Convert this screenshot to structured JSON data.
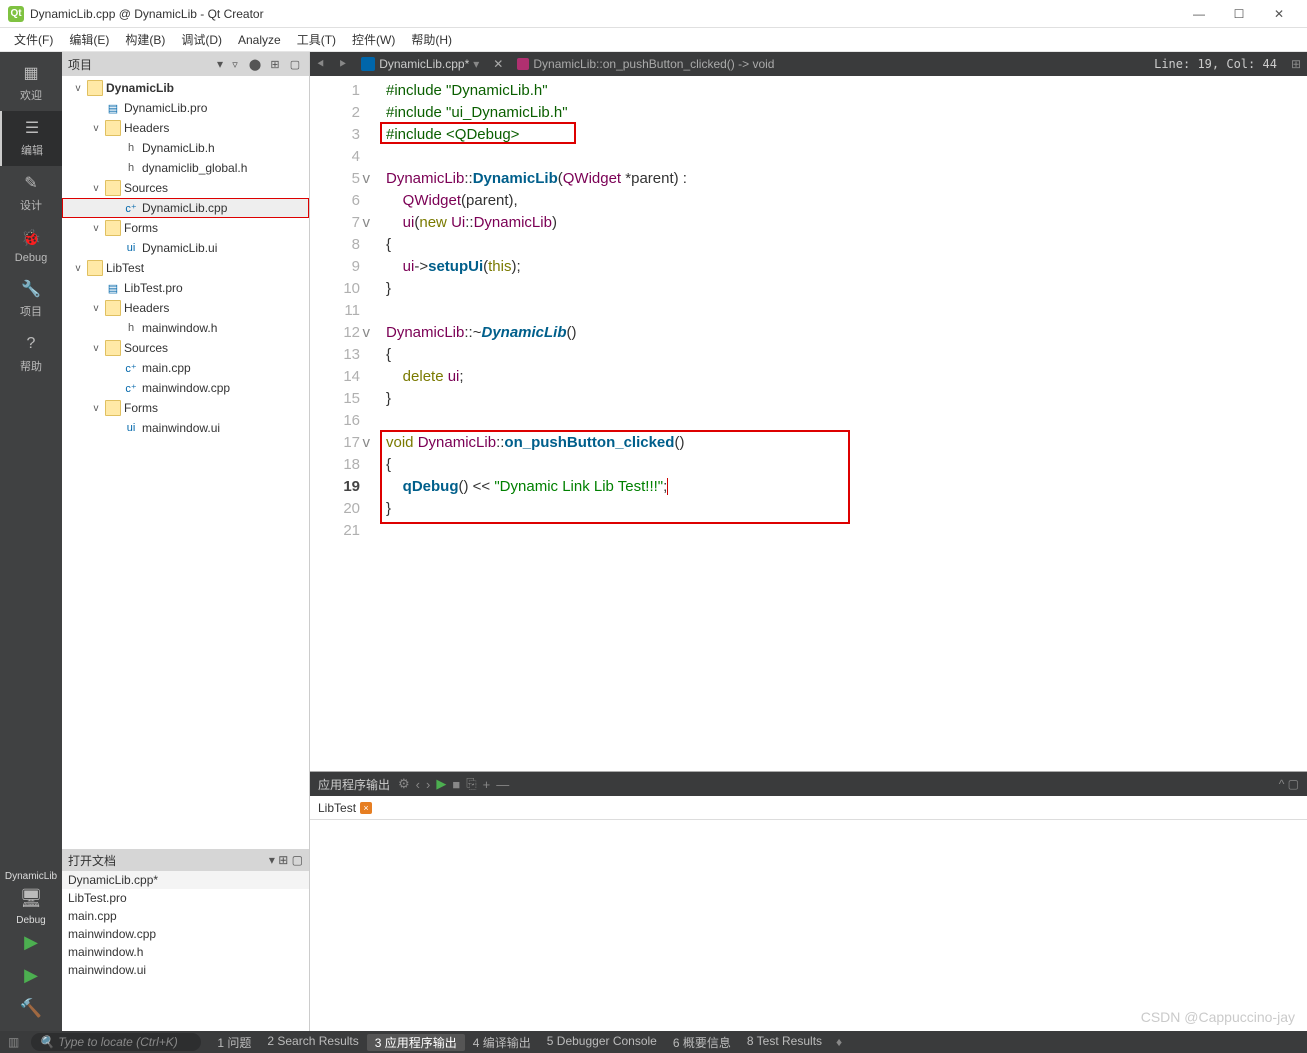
{
  "window": {
    "title": "DynamicLib.cpp @ DynamicLib - Qt Creator"
  },
  "menu": [
    "文件(F)",
    "编辑(E)",
    "构建(B)",
    "调试(D)",
    "Analyze",
    "工具(T)",
    "控件(W)",
    "帮助(H)"
  ],
  "leftbar": {
    "items": [
      {
        "label": "欢迎",
        "icon": "grid-icon"
      },
      {
        "label": "编辑",
        "icon": "edit-icon",
        "active": true
      },
      {
        "label": "设计",
        "icon": "design-icon"
      },
      {
        "label": "Debug",
        "icon": "bug-icon"
      },
      {
        "label": "项目",
        "icon": "wrench-icon"
      },
      {
        "label": "帮助",
        "icon": "help-icon"
      }
    ],
    "target": "DynamicLib",
    "target_mode": "Debug"
  },
  "project_pane": {
    "title": "项目",
    "tree": [
      {
        "ind": 1,
        "arrow": "v",
        "icon": "folder",
        "txt": "DynamicLib",
        "bold": true
      },
      {
        "ind": 2,
        "arrow": "",
        "icon": "pro",
        "txt": "DynamicLib.pro"
      },
      {
        "ind": 2,
        "arrow": "v",
        "icon": "folder",
        "txt": "Headers"
      },
      {
        "ind": 3,
        "arrow": "",
        "icon": "h",
        "txt": "DynamicLib.h"
      },
      {
        "ind": 3,
        "arrow": "",
        "icon": "h",
        "txt": "dynamiclib_global.h"
      },
      {
        "ind": 2,
        "arrow": "v",
        "icon": "folder",
        "txt": "Sources"
      },
      {
        "ind": 3,
        "arrow": "",
        "icon": "cpp",
        "txt": "DynamicLib.cpp",
        "sel": true,
        "redbox": true
      },
      {
        "ind": 2,
        "arrow": "v",
        "icon": "folder",
        "txt": "Forms"
      },
      {
        "ind": 3,
        "arrow": "",
        "icon": "ui",
        "txt": "DynamicLib.ui"
      },
      {
        "ind": 1,
        "arrow": "v",
        "icon": "folder",
        "txt": "LibTest"
      },
      {
        "ind": 2,
        "arrow": "",
        "icon": "pro",
        "txt": "LibTest.pro"
      },
      {
        "ind": 2,
        "arrow": "v",
        "icon": "folder",
        "txt": "Headers"
      },
      {
        "ind": 3,
        "arrow": "",
        "icon": "h",
        "txt": "mainwindow.h"
      },
      {
        "ind": 2,
        "arrow": "v",
        "icon": "folder",
        "txt": "Sources"
      },
      {
        "ind": 3,
        "arrow": "",
        "icon": "cpp",
        "txt": "main.cpp"
      },
      {
        "ind": 3,
        "arrow": "",
        "icon": "cpp",
        "txt": "mainwindow.cpp"
      },
      {
        "ind": 2,
        "arrow": "v",
        "icon": "folder",
        "txt": "Forms"
      },
      {
        "ind": 3,
        "arrow": "",
        "icon": "ui",
        "txt": "mainwindow.ui"
      }
    ],
    "open_title": "打开文档",
    "open_docs": [
      "DynamicLib.cpp*",
      "LibTest.pro",
      "main.cpp",
      "mainwindow.cpp",
      "mainwindow.h",
      "mainwindow.ui"
    ]
  },
  "editor": {
    "tab_name": "DynamicLib.cpp*",
    "breadcrumb": "DynamicLib::on_pushButton_clicked() -> void",
    "position": "Line: 19, Col: 44",
    "lines": [
      {
        "n": 1,
        "html": "<span class='pre'>#include </span><span class='str2'>\"DynamicLib.h\"</span>"
      },
      {
        "n": 2,
        "html": "<span class='pre'>#include </span><span class='str2'>\"ui_DynamicLib.h\"</span>"
      },
      {
        "n": 3,
        "html": "<span class='pre'>#include </span><span class='str2'>&lt;QDebug&gt;</span>"
      },
      {
        "n": 4,
        "html": ""
      },
      {
        "n": 5,
        "fold": "v",
        "html": "<span class='type'>DynamicLib</span>::<span class='fn'>DynamicLib</span>(<span class='type'>QWidget</span> *parent) :"
      },
      {
        "n": 6,
        "html": "    <span class='type'>QWidget</span>(parent),"
      },
      {
        "n": 7,
        "fold": "v",
        "html": "    <span class='type'>ui</span>(<span class='kw'>new</span> <span class='type'>Ui</span>::<span class='type'>DynamicLib</span>)"
      },
      {
        "n": 8,
        "html": "{"
      },
      {
        "n": 9,
        "html": "    <span class='type'>ui</span>-&gt;<span class='fn'>setupUi</span>(<span class='kw'>this</span>);"
      },
      {
        "n": 10,
        "html": "}"
      },
      {
        "n": 11,
        "html": ""
      },
      {
        "n": 12,
        "fold": "v",
        "html": "<span class='type'>DynamicLib</span>::~<span class='fni'>DynamicLib</span>()"
      },
      {
        "n": 13,
        "html": "{"
      },
      {
        "n": 14,
        "html": "    <span class='kw'>delete</span> <span class='type'>ui</span>;"
      },
      {
        "n": 15,
        "html": "}"
      },
      {
        "n": 16,
        "html": ""
      },
      {
        "n": 17,
        "fold": "v",
        "html": "<span class='kw'>void</span> <span class='type'>DynamicLib</span>::<span class='fn'>on_pushButton_clicked</span>()"
      },
      {
        "n": 18,
        "html": "{"
      },
      {
        "n": 19,
        "act": true,
        "html": "    <span class='fn'>qDebug</span>() &lt;&lt; <span class='str'>\"Dynamic Link Lib Test!!!\"</span>;<span class='cursor'></span>"
      },
      {
        "n": 20,
        "html": "}"
      },
      {
        "n": 21,
        "html": ""
      }
    ]
  },
  "output": {
    "title": "应用程序输出",
    "tab": "LibTest"
  },
  "status": {
    "search_placeholder": "Type to locate (Ctrl+K)",
    "items": [
      "1 问题",
      "2 Search Results",
      "3 应用程序输出",
      "4 编译输出",
      "5 Debugger Console",
      "6 概要信息",
      "8 Test Results"
    ],
    "active": 2
  },
  "watermark": "CSDN @Cappuccino-jay"
}
